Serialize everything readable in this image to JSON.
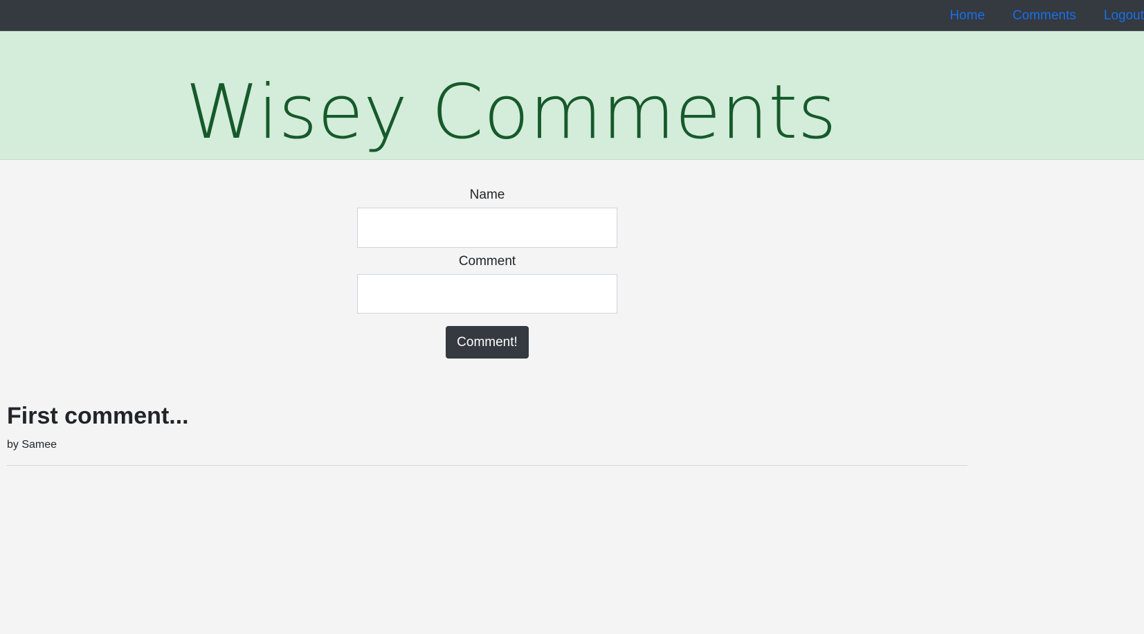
{
  "nav": {
    "links": [
      {
        "label": "Home"
      },
      {
        "label": "Comments"
      },
      {
        "label": "Logout"
      }
    ]
  },
  "hero": {
    "title": "Wisey Comments"
  },
  "form": {
    "name_label": "Name",
    "name_value": "",
    "comment_label": "Comment",
    "comment_value": "",
    "submit_label": "Comment!"
  },
  "comments": [
    {
      "title": "First comment...",
      "author": "by Samee"
    }
  ],
  "colors": {
    "navbar_bg": "#343a40",
    "nav_link": "#1a6ee8",
    "hero_bg": "#d4ecda",
    "hero_text": "#165a2b",
    "page_bg": "#f4f4f4"
  }
}
